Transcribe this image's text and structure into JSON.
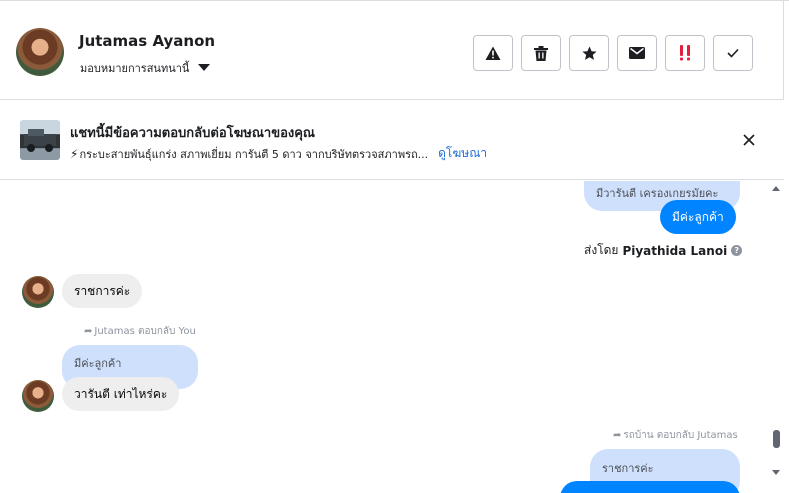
{
  "header": {
    "user_name": "Jutamas Ayanon",
    "assign_label": "มอบหมายการสนทนานี้",
    "actions": [
      {
        "name": "spam-icon",
        "label": "Report"
      },
      {
        "name": "trash-icon",
        "label": "Delete"
      },
      {
        "name": "star-icon",
        "label": "Star"
      },
      {
        "name": "mail-icon",
        "label": "Mark unread"
      },
      {
        "name": "follow-up-icon",
        "label": "Follow up"
      },
      {
        "name": "check-icon",
        "label": "Done"
      }
    ]
  },
  "ad_banner": {
    "title": "แชทนี้มีข้อความตอบกลับต่อโฆษณาของคุณ",
    "description": "กระบะสายพันธุ์แกร่ง สภาพเยี่ยม การันตี 5 ดาว จากบริษัทตรวจสภาพรถ...",
    "link": "ดูโฆษณา"
  },
  "messages": {
    "m1_quoted": "มีวารันตี เครองเกยรมัยคะ",
    "m1_text": "มีค่ะลูกค้า",
    "sent_by_prefix": "ส่งโดย",
    "sent_by_name": "Piyathida Lanoi",
    "m2_text": "ราชการค่ะ",
    "m3_reply_note": "Jutamas ตอบกลับ You",
    "m3_quoted": "มีค่ะลูกค้า",
    "m3_text": "วารันตี เท่าไหร่คะ",
    "m4_reply_note": "รถบ้าน ตอบกลับ Jutamas",
    "m4_quoted": "ราชการค่ะ"
  },
  "colors": {
    "accent": "#0084ff",
    "quoted": "#cfe0fc",
    "incoming": "#eeeeee",
    "link": "#216fdb",
    "follow_up": "#e41e3f"
  }
}
